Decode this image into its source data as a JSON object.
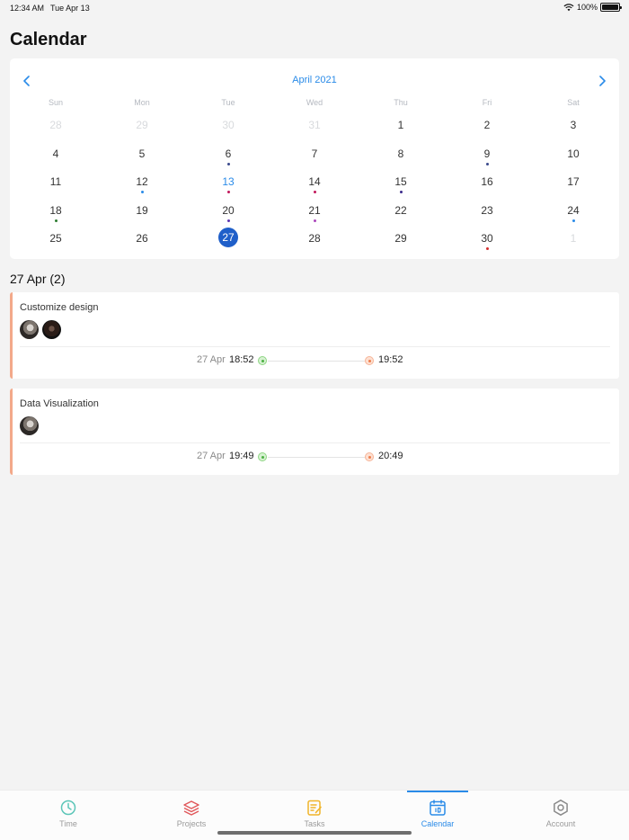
{
  "status_bar": {
    "time": "12:34 AM",
    "date": "Tue Apr 13",
    "battery": "100%"
  },
  "page_title": "Calendar",
  "calendar": {
    "month_label": "April 2021",
    "weekdays": [
      "Sun",
      "Mon",
      "Tue",
      "Wed",
      "Thu",
      "Fri",
      "Sat"
    ],
    "days": [
      {
        "n": "28",
        "muted": true
      },
      {
        "n": "29",
        "muted": true
      },
      {
        "n": "30",
        "muted": true
      },
      {
        "n": "31",
        "muted": true
      },
      {
        "n": "1"
      },
      {
        "n": "2"
      },
      {
        "n": "3"
      },
      {
        "n": "4"
      },
      {
        "n": "5"
      },
      {
        "n": "6",
        "dot": "#3b4a8c"
      },
      {
        "n": "7"
      },
      {
        "n": "8"
      },
      {
        "n": "9",
        "dot": "#3b4a8c"
      },
      {
        "n": "10"
      },
      {
        "n": "11"
      },
      {
        "n": "12",
        "dot": "#2a8be8"
      },
      {
        "n": "13",
        "today": true,
        "dot": "#c2185b"
      },
      {
        "n": "14",
        "dot": "#c2185b"
      },
      {
        "n": "15",
        "dot": "#3b2a8c"
      },
      {
        "n": "16"
      },
      {
        "n": "17"
      },
      {
        "n": "18",
        "dot": "#2e7d32"
      },
      {
        "n": "19"
      },
      {
        "n": "20",
        "dot": "#5e35b1"
      },
      {
        "n": "21",
        "dot": "#ab47bc"
      },
      {
        "n": "22"
      },
      {
        "n": "23"
      },
      {
        "n": "24",
        "dot": "#2a8be8"
      },
      {
        "n": "25"
      },
      {
        "n": "26"
      },
      {
        "n": "27",
        "selected": true
      },
      {
        "n": "28"
      },
      {
        "n": "29"
      },
      {
        "n": "30",
        "dot": "#d32f2f"
      },
      {
        "n": "1",
        "muted": true
      }
    ]
  },
  "section_title": "27 Apr (2)",
  "tasks": [
    {
      "name": "Customize design",
      "start_date": "27 Apr",
      "start_time": "18:52",
      "end_time": "19:52",
      "avatars": 2
    },
    {
      "name": "Data Visualization",
      "start_date": "27 Apr",
      "start_time": "19:49",
      "end_time": "20:49",
      "avatars": 1
    }
  ],
  "tabs": [
    {
      "label": "Time",
      "icon": "clock-icon",
      "color": "#5cc6b8"
    },
    {
      "label": "Projects",
      "icon": "layers-icon",
      "color": "#e0575a"
    },
    {
      "label": "Tasks",
      "icon": "notepad-icon",
      "color": "#f0b429"
    },
    {
      "label": "Calendar",
      "icon": "calendar-icon",
      "color": "#2a8be8",
      "active": true
    },
    {
      "label": "Account",
      "icon": "gear-icon",
      "color": "#8a8a8a"
    }
  ]
}
